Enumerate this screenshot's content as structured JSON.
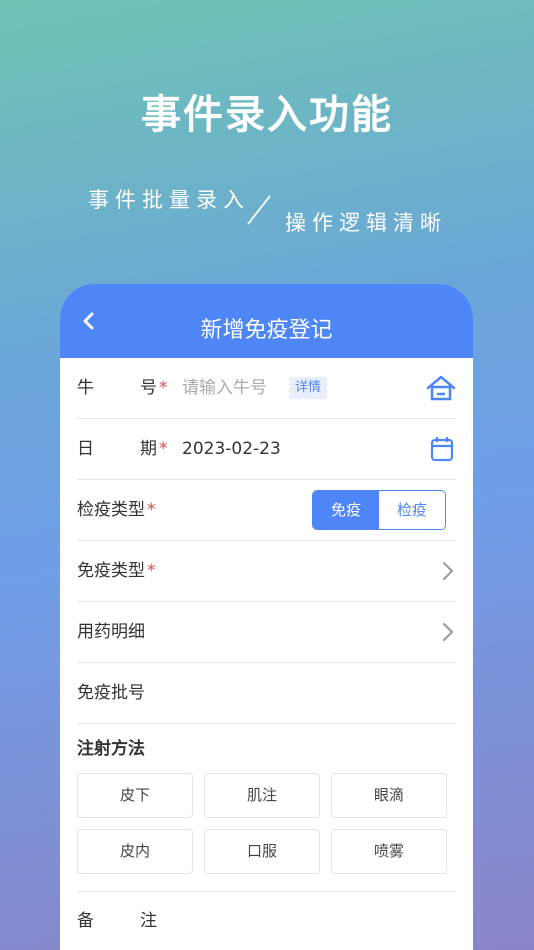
{
  "hero": {
    "title": "事件录入功能",
    "tag1": "事件批量录入",
    "tag2": "操作逻辑清晰"
  },
  "header": {
    "title": "新增免疫登记",
    "back_icon": "chevron-left-icon"
  },
  "form": {
    "cow_no": {
      "label_a": "牛",
      "label_b": "号",
      "required": "*",
      "placeholder": "请输入牛号",
      "detail": "详情",
      "icon": "home-icon"
    },
    "date": {
      "label_a": "日",
      "label_b": "期",
      "required": "*",
      "value": "2023-02-23",
      "icon": "calendar-icon"
    },
    "check_type": {
      "label": "检疫类型",
      "required": "*",
      "options": [
        "免疫",
        "检疫"
      ],
      "selected": "免疫"
    },
    "immune_type": {
      "label": "免疫类型",
      "required": "*"
    },
    "drug_detail": {
      "label": "用药明细"
    },
    "batch_no": {
      "label": "免疫批号"
    },
    "injection": {
      "title": "注射方法",
      "options": [
        "皮下",
        "肌注",
        "眼滴",
        "皮内",
        "口服",
        "喷雾"
      ]
    },
    "remark": {
      "label_a": "备",
      "label_b": "注"
    }
  },
  "colors": {
    "accent": "#4f86f7",
    "required": "#e24a4a"
  }
}
